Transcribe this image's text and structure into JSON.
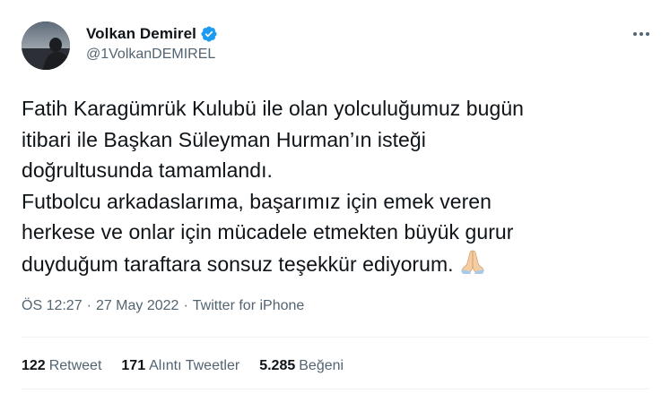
{
  "author": {
    "display_name": "Volkan Demirel",
    "handle": "@1VolkanDEMIREL",
    "verified": true,
    "avatar_icon": "profile-photo-silhouette",
    "verified_icon": "verified-badge-icon"
  },
  "tweet": {
    "lines": [
      "Fatih Karagümrük Kulubü ile olan yolculuğumuz bugün",
      "itibari ile Başkan Süleyman Hurman’ın isteği",
      "doğrultusunda tamamlandı.",
      "Futbolcu arkadaslarıma, başarımız için emek veren",
      "herkese ve onlar için mücadele etmekten büyük gurur",
      "duyduğum  taraftara sonsuz teşekkür ediyorum."
    ],
    "emoji_icon": "folded-hands-emoji"
  },
  "meta": {
    "time": "ÖS 12:27",
    "date": "27 May 2022",
    "source": "Twitter for iPhone",
    "separator": "·"
  },
  "stats": {
    "retweets_count": "122",
    "retweets_label": "Retweet",
    "quotes_count": "171",
    "quotes_label": "Alıntı Tweetler",
    "likes_count": "5.285",
    "likes_label": "Beğeni"
  },
  "colors": {
    "text_primary": "#0f1419",
    "text_secondary": "#536471",
    "verified_blue": "#1d9bf0",
    "divider": "#eff3f4"
  }
}
